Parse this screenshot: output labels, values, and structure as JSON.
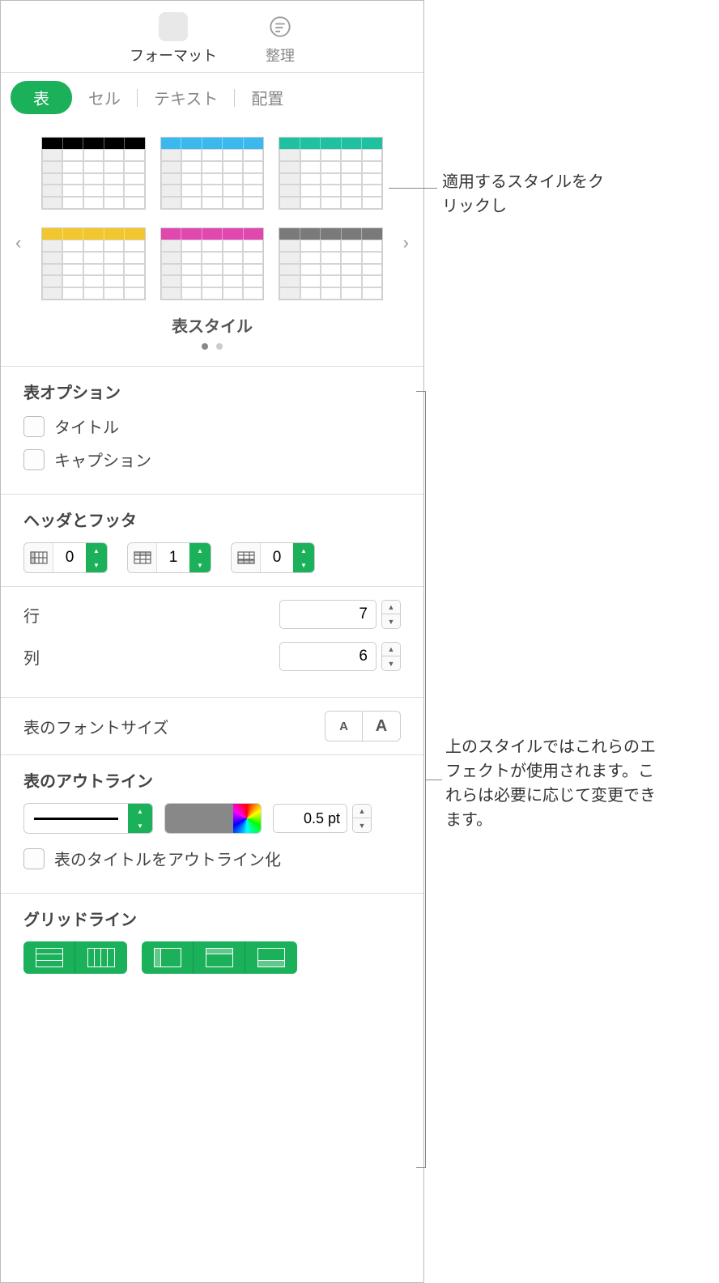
{
  "topTabs": {
    "format": "フォーマット",
    "organize": "整理"
  },
  "subTabs": {
    "table": "表",
    "cell": "セル",
    "text": "テキスト",
    "arrange": "配置"
  },
  "styles": {
    "title": "表スタイル",
    "colors": [
      "#000000",
      "#3bb9ee",
      "#1fc1a0",
      "#f2c62f",
      "#e048b0",
      "#7a7a7a"
    ]
  },
  "options": {
    "title": "表オプション",
    "titleCheckbox": "タイトル",
    "captionCheckbox": "キャプション"
  },
  "headersFooters": {
    "title": "ヘッダとフッタ",
    "headerCols": "0",
    "headerRows": "1",
    "footerRows": "0"
  },
  "dimensions": {
    "rowsLabel": "行",
    "rows": "7",
    "colsLabel": "列",
    "cols": "6"
  },
  "fontSize": {
    "label": "表のフォントサイズ"
  },
  "outline": {
    "title": "表のアウトライン",
    "pt": "0.5 pt",
    "outlineTitle": "表のタイトルをアウトライン化"
  },
  "gridlines": {
    "title": "グリッドライン"
  },
  "annotations": {
    "styleClick": "適用するスタイルをクリックし",
    "effects": "上のスタイルではこれらのエフェクトが使用されます。これらは必要に応じて変更できます。"
  }
}
